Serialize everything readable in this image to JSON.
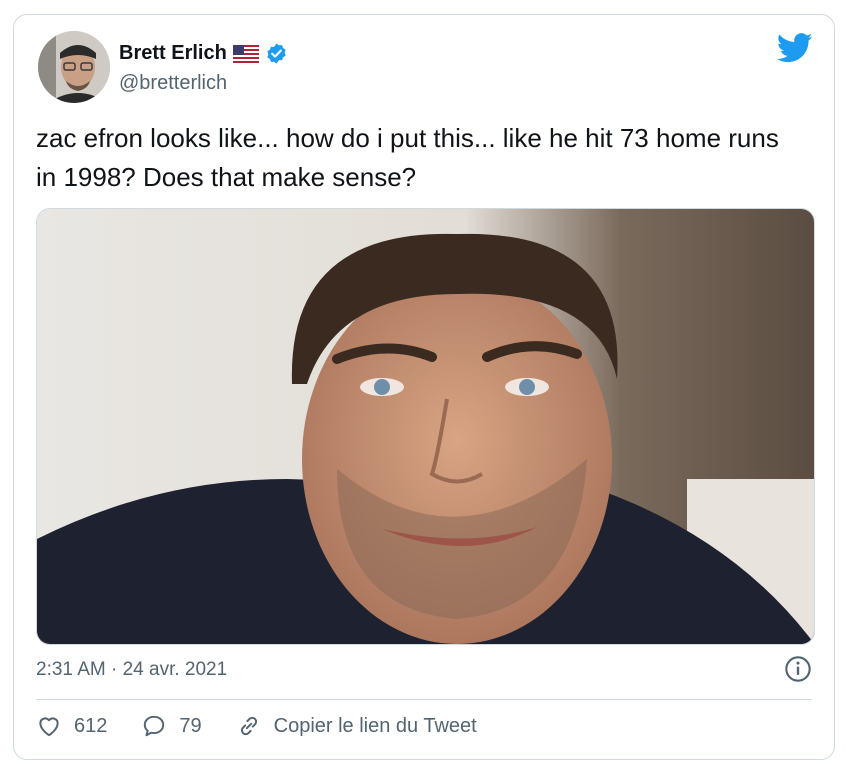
{
  "tweet": {
    "author_name": "Brett Erlich",
    "author_handle": "@bretterlich",
    "text": "zac efron looks like... how do i put this... like he hit 73 home runs in 1998? Does that make sense?",
    "timestamp": "2:31 AM · 24 avr. 2021",
    "likes": "612",
    "replies": "79",
    "copy_link_label": "Copier le lien du Tweet"
  },
  "icons": {
    "flag": "us-flag-icon",
    "verified": "verified-badge-icon",
    "brand": "twitter-bird-icon",
    "info": "info-icon",
    "like": "heart-icon",
    "reply": "speech-bubble-icon",
    "copy_link": "link-icon"
  },
  "colors": {
    "twitter_blue": "#1d9bf0",
    "text": "#0f1419",
    "muted": "#536471",
    "border": "#cfd9de"
  }
}
